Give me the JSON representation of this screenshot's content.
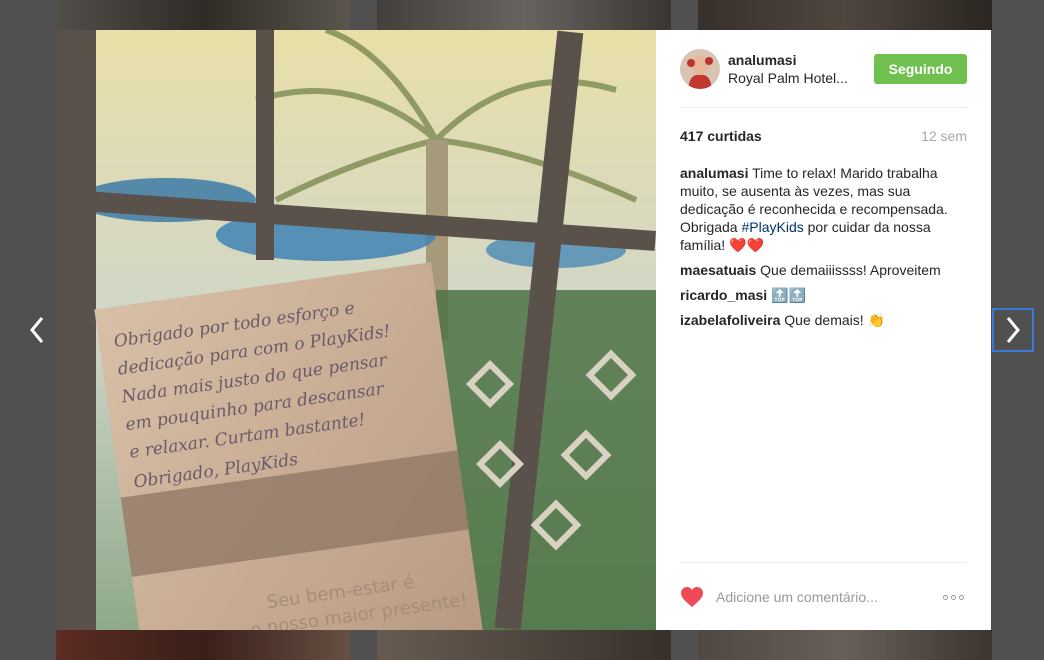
{
  "post": {
    "username": "analumasi",
    "location": "Royal Palm Hotel...",
    "follow_label": "Seguindo",
    "likes": "417 curtidas",
    "time": "12 sem"
  },
  "caption": {
    "user": "analumasi",
    "text_before": " Time to relax! Marido trabalha muito, se ausenta às vezes, mas sua dedicação é reconhecida e recompensada. Obrigada ",
    "hashtag": "#PlayKids",
    "text_after": " por cuidar da nossa família! ❤️❤️"
  },
  "comments": [
    {
      "user": "maesatuais",
      "text": "Que demaiiissss! Aproveitem"
    },
    {
      "user": "ricardo_masi",
      "text": "🔝🔝"
    },
    {
      "user": "izabelafoliveira",
      "text": "Que demais! 👏"
    }
  ],
  "footer": {
    "placeholder": "Adicione um comentário..."
  },
  "photo_card_text": [
    "Obrigado por todo esforço e",
    "dedicação para com o PlayKids!",
    "Nada mais justo do que pensar",
    "em pouquinho para descansar",
    "e relaxar. Curtam bastante!",
    "Obrigado, PlayKids"
  ],
  "photo_card_printed": [
    "Seu bem-estar é",
    "o nosso maior presente!"
  ],
  "colors": {
    "follow": "#70c050",
    "heart": "#ed4956",
    "hashtag": "#003569",
    "focus": "#3a7bd5"
  }
}
